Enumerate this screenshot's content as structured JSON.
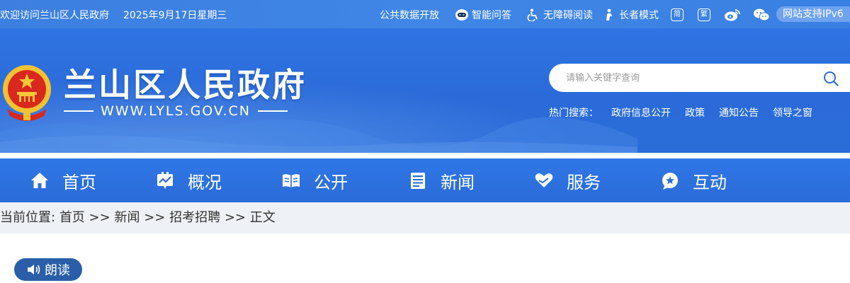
{
  "topbar": {
    "welcome": "欢迎访问兰山区人民政府",
    "date": "2025年9月17日星期三",
    "open_data": "公共数据开放",
    "smart_qa": "智能问答",
    "accessible": "无障碍阅读",
    "elder_mode": "长者模式",
    "simplified": "简",
    "traditional": "繁",
    "ipv6": "网站支持IPv6"
  },
  "header": {
    "site_title": "兰山区人民政府",
    "site_url": "WWW.LYLS.GOV.CN",
    "search_placeholder": "请输入关键字查询",
    "hot_label": "热门搜索：",
    "hot_links": [
      "政府信息公开",
      "政策",
      "通知公告",
      "领导之窗"
    ]
  },
  "nav": {
    "items": [
      {
        "label": "首页",
        "icon": "home-icon"
      },
      {
        "label": "概况",
        "icon": "overview-icon"
      },
      {
        "label": "公开",
        "icon": "book-icon"
      },
      {
        "label": "新闻",
        "icon": "news-icon"
      },
      {
        "label": "服务",
        "icon": "heart-hands-icon"
      },
      {
        "label": "互动",
        "icon": "chat-icon"
      }
    ]
  },
  "breadcrumb": {
    "prefix": "当前位置:",
    "items": [
      "首页",
      "新闻",
      "招考招聘",
      "正文"
    ],
    "separator": ">>"
  },
  "article": {
    "read_aloud": "朗读"
  },
  "colors": {
    "topbar": "#3c7fe0",
    "banner": "#2f74e2",
    "nav": "#2a6bd8",
    "crumb_bg": "#eef1f5",
    "read_btn": "#2a5ea8"
  }
}
